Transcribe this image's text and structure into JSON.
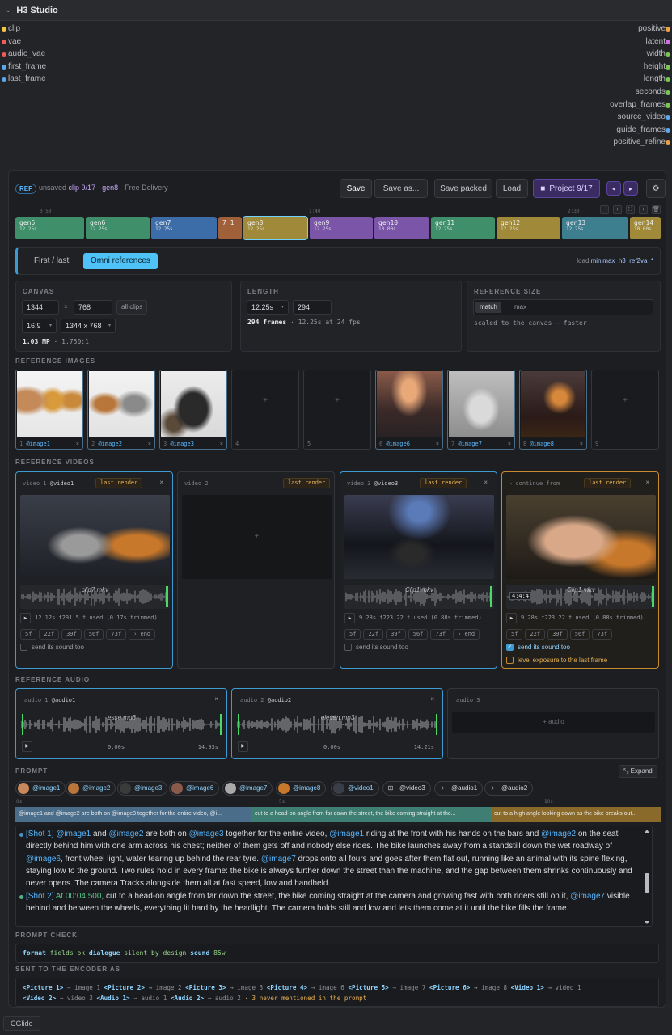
{
  "node": {
    "title": "H3 Studio"
  },
  "inputs": [
    {
      "label": "clip",
      "color": "#f5c542"
    },
    {
      "label": "vae",
      "color": "#ef5b5b"
    },
    {
      "label": "audio_vae",
      "color": "#ef5b5b"
    },
    {
      "label": "first_frame",
      "color": "#5aa8f0"
    },
    {
      "label": "last_frame",
      "color": "#5aa8f0"
    }
  ],
  "outputs": [
    {
      "label": "positive",
      "color": "#f0a040"
    },
    {
      "label": "latent",
      "color": "#d070e0"
    },
    {
      "label": "width",
      "color": "#78c850"
    },
    {
      "label": "height",
      "color": "#78c850"
    },
    {
      "label": "length",
      "color": "#78c850"
    },
    {
      "label": "seconds",
      "color": "#78c850"
    },
    {
      "label": "overlap_frames",
      "color": "#78c850"
    },
    {
      "label": "source_video",
      "color": "#5aa8f0"
    },
    {
      "label": "guide_frames",
      "color": "#5aa8f0"
    },
    {
      "label": "positive_refine",
      "color": "#f0a040"
    }
  ],
  "toolbar": {
    "ref_badge": "REF",
    "status_prefix": "unsaved",
    "clip_label": "clip 9/17",
    "gen_label": "gen8",
    "suffix": "· Free Delivery",
    "save": "Save",
    "save_as": "Save as...",
    "save_packed": "Save packed",
    "load": "Load",
    "project": "Project 9/17",
    "prev": "◂",
    "next": "▸",
    "settings": "⚙"
  },
  "timeline": {
    "ticks": [
      "0:50",
      "1:40",
      "2:30"
    ],
    "buttons": [
      "−",
      "+",
      "⛶",
      "+",
      "🗑"
    ],
    "clips": [
      {
        "name": "gen5",
        "dur": "12.25s",
        "color": "#3f8f6b"
      },
      {
        "name": "gen6",
        "dur": "12.25s",
        "color": "#3f8f6b"
      },
      {
        "name": "gen7",
        "dur": "12.25s",
        "color": "#3d6da8"
      },
      {
        "name": "7_1",
        "dur": "",
        "color": "#a0603a"
      },
      {
        "name": "gen8",
        "dur": "12.25s",
        "color": "#a08a3a"
      },
      {
        "name": "gen9",
        "dur": "12.25s",
        "color": "#7a55a8"
      },
      {
        "name": "gen10",
        "dur": "10.00s",
        "color": "#7a55a8"
      },
      {
        "name": "gen11",
        "dur": "12.25s",
        "color": "#3f8f6b"
      },
      {
        "name": "gen12",
        "dur": "12.25s",
        "color": "#a08a3a"
      },
      {
        "name": "gen13",
        "dur": "12.25s",
        "color": "#3d7e8f"
      },
      {
        "name": "gen14",
        "dur": "10.00s",
        "color": "#a08a3a"
      }
    ]
  },
  "mode": {
    "tabs": [
      "First / last",
      "Omni references"
    ],
    "active": 1,
    "load_prefix": "load",
    "load_file": "minimax_h3_ref2va_*"
  },
  "canvas": {
    "label": "CANVAS",
    "width": "1344",
    "height": "768",
    "all_clips": "all clips",
    "ratio": "16:9",
    "preset": "1344 x 768",
    "summary_bold": "1.03 MP",
    "summary_rest": "· 1.750:1"
  },
  "length": {
    "label": "LENGTH",
    "seconds": "12.25s",
    "frames": "294",
    "summary_bold": "294 frames",
    "summary_rest": "· 12.25s at 24 fps"
  },
  "refsize": {
    "label": "REFERENCE SIZE",
    "opt1": "match",
    "opt2": "max",
    "note": "scaled to the canvas — faster"
  },
  "ref_images": {
    "label": "REFERENCE IMAGES",
    "slots": [
      {
        "num": "1",
        "tag": "@image1",
        "filled": true
      },
      {
        "num": "2",
        "tag": "@image2",
        "filled": true
      },
      {
        "num": "3",
        "tag": "@image3",
        "filled": true
      },
      {
        "num": "4",
        "tag": "",
        "filled": false
      },
      {
        "num": "5",
        "tag": "",
        "filled": false
      },
      {
        "num": "6",
        "tag": "@image6",
        "filled": true
      },
      {
        "num": "7",
        "tag": "@image7",
        "filled": true
      },
      {
        "num": "8",
        "tag": "@image8",
        "filled": true
      },
      {
        "num": "9",
        "tag": "",
        "filled": false
      }
    ]
  },
  "ref_videos": {
    "label": "REFERENCE VIDEOS",
    "slots": [
      {
        "head": "video 1",
        "tag": "@video1",
        "badge": "last render",
        "file": "clip7.mkv",
        "meta": "12.12s f291  5 f used (0.17s trimmed)",
        "chips": [
          "5f",
          "22f",
          "39f",
          "56f",
          "73f",
          "› end"
        ],
        "sound": "send its sound too",
        "sound_on": false
      },
      {
        "head": "video 2",
        "tag": "",
        "badge": "last render"
      },
      {
        "head": "video 3",
        "tag": "@video3",
        "badge": "last render",
        "file": "Clip1.mkv",
        "meta": "9.28s f223  22 f used (0.88s trimmed)",
        "chips": [
          "5f",
          "22f",
          "39f",
          "56f",
          "73f",
          "› end"
        ],
        "sound": "send its sound too",
        "sound_on": false
      },
      {
        "head": "↦ continue from",
        "tag": "",
        "badge": "last render",
        "file": "Clip1.mkv",
        "meta": "9.28s f223  22 f used (0.88s trimmed)",
        "chips": [
          "5f",
          "22f",
          "39f",
          "56f",
          "73f"
        ],
        "sound": "send its sound too",
        "sound_on": true,
        "exposure": "level exposure to the last frame",
        "tc": "4:4:4"
      }
    ]
  },
  "ref_audio": {
    "label": "REFERENCE AUDIO",
    "slots": [
      {
        "head": "audio 1",
        "tag": "@audio1",
        "file": "esse.mp3",
        "start": "0.00s",
        "end": "14.93s"
      },
      {
        "head": "audio 2",
        "tag": "@audio2",
        "file": "eleven.mp3",
        "start": "0.00s",
        "end": "14.21s"
      },
      {
        "head": "audio 3",
        "tag": "",
        "add": "+ audio"
      }
    ]
  },
  "prompt": {
    "label": "PROMPT",
    "expand": "⤡ Expand",
    "tags": [
      "@image1",
      "@image2",
      "@image3",
      "@image6",
      "@image7",
      "@image8",
      "@video1",
      "@video3",
      "@audio1",
      "@audio2"
    ],
    "seg_ticks": [
      "0s",
      "5s",
      "10s"
    ],
    "segments": [
      {
        "text": "@image1 and @image2 are both on @image3 together for the entire video, @i...",
        "color": "#4a6d8a"
      },
      {
        "text": "cut to a head-on angle from far down the street, the bike coming straight at the...",
        "color": "#3f7f73"
      },
      {
        "text": "cut to a high angle looking down as the bike breaks out...",
        "color": "#8a6a2a"
      }
    ],
    "shot1": "[Shot 1] @image1 and @image2 are both on @image3 together for the entire video, @image1 riding at the front with his hands on the bars and @image2 on the seat directly behind him with one arm across his chest; neither of them gets off and nobody else rides. The bike launches away from a standstill down the wet roadway of @image6, front wheel light, water tearing up behind the rear tyre. @image7 drops onto all fours and goes after them flat out, running like an animal with its spine flexing, staying low to the ground. Two rules hold in every frame: the bike is always further down the street than the machine, and the gap between them shrinks continuously and never opens. The camera Tracks alongside them all at fast speed, low and handheld.",
    "shot2": "[Shot 2] At 00:04.500, cut to a head-on angle from far down the street, the bike coming straight at the camera and growing fast with both riders still on it, @image7 visible behind and between the wheels, everything lit hard by the headlight. The camera holds still and low and lets them come at it until the bike fills the frame."
  },
  "prompt_check": {
    "label": "PROMPT CHECK",
    "items": [
      {
        "k": "format",
        "v": "fields ok"
      },
      {
        "k": "dialogue",
        "v": "silent by design"
      },
      {
        "k": "sound",
        "v": "85w"
      }
    ]
  },
  "encoder": {
    "label": "SENT TO THE ENCODER AS",
    "line1": [
      {
        "k": "<Picture 1>",
        "v": "image 1"
      },
      {
        "k": "<Picture 2>",
        "v": "image 2"
      },
      {
        "k": "<Picture 3>",
        "v": "image 3"
      },
      {
        "k": "<Picture 4>",
        "v": "image 6"
      },
      {
        "k": "<Picture 5>",
        "v": "image 7"
      },
      {
        "k": "<Picture 6>",
        "v": "image 8"
      },
      {
        "k": "<Video 1>",
        "v": "video 1"
      }
    ],
    "line2": [
      {
        "k": "<Video 2>",
        "v": "video 3"
      },
      {
        "k": "<Audio 1>",
        "v": "audio 1"
      },
      {
        "k": "<Audio 2>",
        "v": "audio 2"
      }
    ],
    "warning": "· 3 never mentioned in the prompt"
  },
  "footer": {
    "label": "CGlide"
  }
}
